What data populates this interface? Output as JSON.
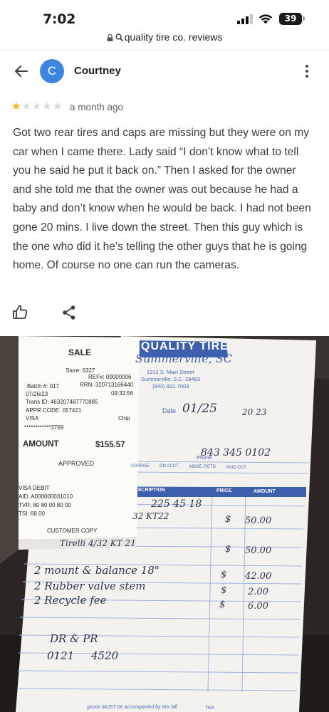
{
  "status_bar": {
    "time": "7:02",
    "battery": "39"
  },
  "browser": {
    "url_text": "quality tire co. reviews"
  },
  "review": {
    "reviewer_initial": "C",
    "reviewer_name": "Courtney",
    "rating": 1,
    "rating_max": 5,
    "date": "a month ago",
    "text": "Got two rear tires and caps are missing but they were on my car when I came there. Lady said “I don’t know what to tell you he said he put it back on.” Then I asked for the owner and she told me that the owner was out because he had a baby and don’t know when he would be back. I had not been gone 20 mins. I live down the street. Then this guy which is the one who did it he’s telling the other guys that he is going home. Of course no one can run the cameras."
  },
  "icons": {
    "back": "arrow-left-icon",
    "more": "more-vert-icon",
    "like": "thumb-up-icon",
    "share": "share-icon",
    "lock": "lock-icon",
    "search": "search-icon"
  },
  "colors": {
    "avatar": "#3d85e0",
    "star_filled": "#f4b400",
    "star_empty": "#d8d8d8"
  },
  "photo": {
    "receipt": {
      "title": "SALE",
      "store": "Store: 6327",
      "ref": "REF#: 00000006",
      "batch": "Batch #: 017",
      "rrn": "RRN: 320713166440",
      "date": "07/26/23",
      "time": "09:32:56",
      "trans_id": "Trans ID: 463207487770885",
      "appr_code": "APPR CODE: 057421",
      "card_type": "VISA",
      "chip": "Chip",
      "card_number": "************3769",
      "amount_label": "AMOUNT",
      "amount": "$155.57",
      "status": "APPROVED",
      "debit": "VISA DEBIT",
      "aid": "AID: A000000031010",
      "tvr": "TVR: 80 80 00 80 00",
      "tsi": "TSI: 68 00",
      "copy": "CUSTOMER COPY"
    },
    "invoice": {
      "company": "QUALITY TIRE",
      "city": "Summerville, SC",
      "address1": "1312 S. Main Street",
      "address2": "Summerville, S.C. 29483",
      "phone": "(843) 821-7003",
      "date_label": "Date",
      "date_value": "01/25",
      "year": "20 23",
      "phone_label": "Phone",
      "phone_value": "843 345 0102",
      "col_charge": "CHARGE",
      "col_on_acct": "ON ACCT",
      "col_mdse_retd": "MDSE. RETD",
      "col_paid_out": "PAID OUT",
      "col_description": "DESCRIPTION",
      "col_price": "PRICE",
      "col_amount": "AMOUNT",
      "line_tire_size": "225 45 18",
      "lines": [
        {
          "text": "32 KT22",
          "price": "$",
          "amount": "50.00"
        },
        {
          "text": "Tirelli 4/32 KT 21",
          "price": "$",
          "amount": "50.00"
        },
        {
          "text": "2 mount & balance 18\"",
          "price": "$",
          "amount": "42.00"
        },
        {
          "text": "2 Rubber valve stem",
          "price": "$",
          "amount": "2.00"
        },
        {
          "text": "2 Recycle fee",
          "price": "$",
          "amount": "6.00"
        }
      ],
      "note_line1": "DR & PR",
      "note_line2": "0121     4520",
      "footer": "goods MUST be accompanied by this bill",
      "tax_label": "TAX"
    }
  }
}
